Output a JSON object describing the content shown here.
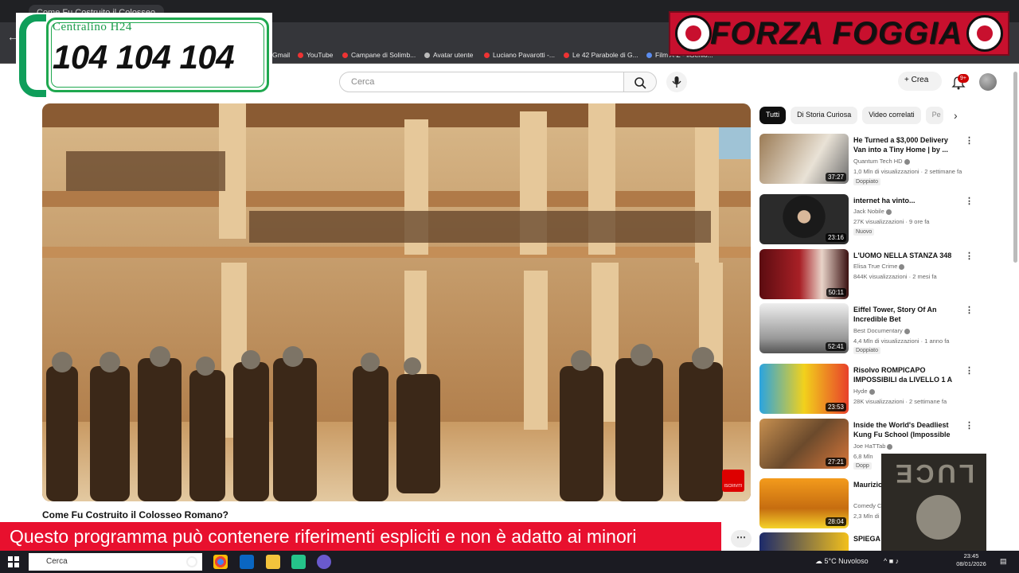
{
  "browser": {
    "tab_title": "Come Fu Costruito il Colosseo...",
    "bookmarks": [
      {
        "label": "Gmail"
      },
      {
        "label": "YouTube"
      },
      {
        "label": "Campane di Solimb..."
      },
      {
        "label": "Avatar utente"
      },
      {
        "label": "Luciano Pavarotti -..."
      },
      {
        "label": "Le 42 Parabole di G..."
      },
      {
        "label": "Film A-Z - ilGenio..."
      }
    ]
  },
  "overlays": {
    "phone_label": "Centralino H24",
    "phone_number": "104 104 104",
    "brand_banner": "FORZA FOGGIA",
    "warning": "Questo programma  può contenere riferimenti espliciti e non è adatto ai minori",
    "luce_logo": "LUCE"
  },
  "youtube": {
    "search_placeholder": "Cerca",
    "create_label": "Crea",
    "notification_count": "9+",
    "video_title": "Come Fu Costruito il Colosseo Romano?",
    "subscribe_badge": "ISCRIVITI",
    "chips": [
      "Tutti",
      "Di Storia Curiosa",
      "Video correlati",
      "Pe"
    ],
    "recommendations": [
      {
        "title": "He Turned a $3,000 Delivery Van into a Tiny Home | by ...",
        "channel": "Quantum Tech HD",
        "meta": "1,0 Mln di visualizzazioni · 2 settimane fa",
        "tag": "Doppiato",
        "duration": "37:27"
      },
      {
        "title": "internet ha vinto...",
        "channel": "Jack Nobile",
        "meta": "27K visualizzazioni · 9 ore fa",
        "tag": "Nuovo",
        "duration": "23:16"
      },
      {
        "title": "L'UOMO NELLA STANZA 348",
        "channel": "Elisa True Crime",
        "meta": "844K visualizzazioni · 2 mesi fa",
        "tag": "",
        "duration": "50:11"
      },
      {
        "title": "Eiffel Tower, Story Of An Incredible Bet",
        "channel": "Best Documentary",
        "meta": "4,4 Mln di visualizzazioni · 1 anno fa",
        "tag": "Doppiato",
        "duration": "52:41"
      },
      {
        "title": "Risolvo ROMPICAPO IMPOSSIBILI da LIVELLO 1 A ...",
        "channel": "Hyde",
        "meta": "28K visualizzazioni · 2 settimane fa",
        "tag": "",
        "duration": "23:53"
      },
      {
        "title": "Inside the World's Deadliest Kung Fu School (Impossible ...",
        "channel": "Joe HaTTab",
        "meta": "6,8 Mln",
        "tag": "Dopp",
        "duration": "27:21"
      },
      {
        "title": "Maurizio Battisto",
        "channel": "Comedy C",
        "meta": "2,3 Mln di",
        "tag": "",
        "duration": "28:04"
      },
      {
        "title": "SPIEGA MAGIE",
        "channel": "",
        "meta": "",
        "tag": "",
        "duration": ""
      }
    ]
  },
  "taskbar": {
    "search_placeholder": "Cerca",
    "weather": "5°C  Nuvoloso",
    "time": "23:45",
    "date": "08/01/2026"
  }
}
